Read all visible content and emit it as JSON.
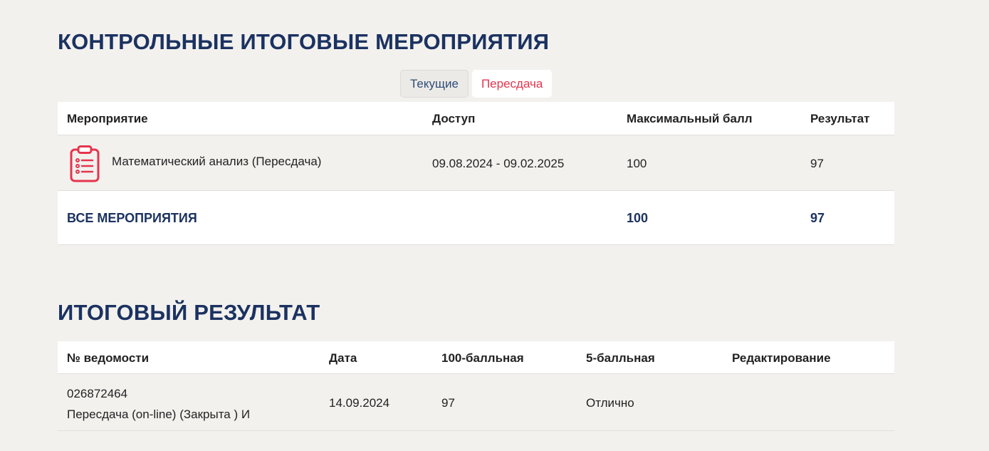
{
  "sections": {
    "events_title": "КОНТРОЛЬНЫЕ ИТОГОВЫЕ МЕРОПРИЯТИЯ",
    "result_title": "ИТОГОВЫЙ РЕЗУЛЬТАТ"
  },
  "tabs": [
    {
      "label": "Текущие",
      "active": false
    },
    {
      "label": "Пересдача",
      "active": true
    }
  ],
  "events_table": {
    "headers": {
      "event": "Мероприятие",
      "access": "Доступ",
      "max": "Максимальный балл",
      "result": "Результат"
    },
    "rows": [
      {
        "icon": "clipboard-list-icon",
        "event": "Математический анализ (Пересдача)",
        "access": "09.08.2024 - 09.02.2025",
        "max": "100",
        "result": "97"
      }
    ],
    "total": {
      "label": "ВСЕ МЕРОПРИЯТИЯ",
      "max": "100",
      "result": "97"
    }
  },
  "result_table": {
    "headers": {
      "number": "№ ведомости",
      "date": "Дата",
      "score100": "100-балльная",
      "score5": "5-балльная",
      "edit": "Редактирование"
    },
    "rows": [
      {
        "number": "026872464",
        "note": "Пересдача (on-line) (Закрыта ) И",
        "date": "14.09.2024",
        "score100": "97",
        "score5": "Отлично",
        "edit": ""
      }
    ]
  },
  "colors": {
    "title": "#1b3261",
    "accent": "#e5354d",
    "background": "#f3f1ee"
  }
}
